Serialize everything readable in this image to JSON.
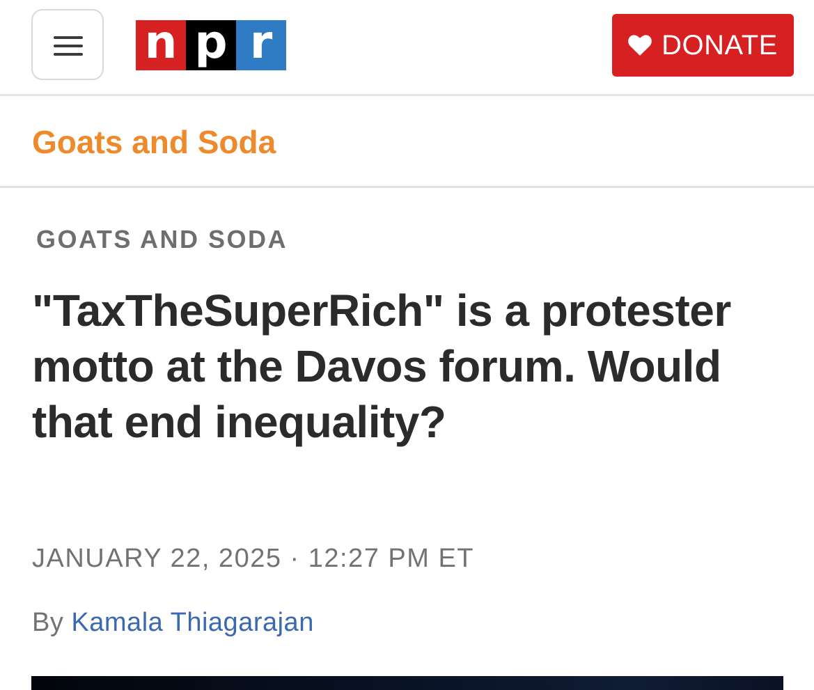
{
  "header": {
    "menu_icon": "hamburger-menu-icon",
    "logo": {
      "letters": [
        "n",
        "p",
        "r"
      ],
      "colors": [
        "#d62021",
        "#000000",
        "#2f7bc4"
      ]
    },
    "donate_label": "DONATE",
    "donate_icon": "heart-icon",
    "donate_color": "#d62021"
  },
  "section": {
    "name": "Goats and Soda",
    "color": "#ee8a2b"
  },
  "article": {
    "slug": "GOATS AND SODA",
    "headline": "\"TaxTheSuperRich\" is a protester motto at the Davos forum. Would that end inequality?",
    "date": "JANUARY 22, 2025 · 12:27 PM ET",
    "byline_prefix": "By",
    "author": "Kamala Thiagarajan"
  }
}
